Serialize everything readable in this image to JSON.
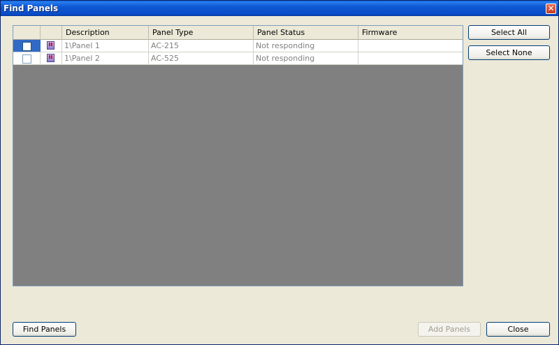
{
  "window": {
    "title": "Find Panels",
    "close_glyph": "✕"
  },
  "grid": {
    "columns": [
      "Description",
      "Panel Type",
      "Panel Status",
      "Firmware"
    ],
    "rows": [
      {
        "description": "1\\Panel 1",
        "panel_type": "AC-215",
        "status": "Not responding",
        "firmware": "",
        "checked": false,
        "selected": true,
        "icon": "panel-icon"
      },
      {
        "description": "1\\Panel 2",
        "panel_type": "AC-525",
        "status": "Not responding",
        "firmware": "",
        "checked": false,
        "selected": false,
        "icon": "panel-icon"
      }
    ]
  },
  "buttons": {
    "select_all": "Select All",
    "select_none": "Select None",
    "find_panels": "Find Panels",
    "add_panels": "Add Panels",
    "close": "Close"
  },
  "colors": {
    "title_bar": "#0a4cc8",
    "selection": "#316ac5",
    "grid_background": "#808080",
    "dialog": "#ece9d8"
  }
}
